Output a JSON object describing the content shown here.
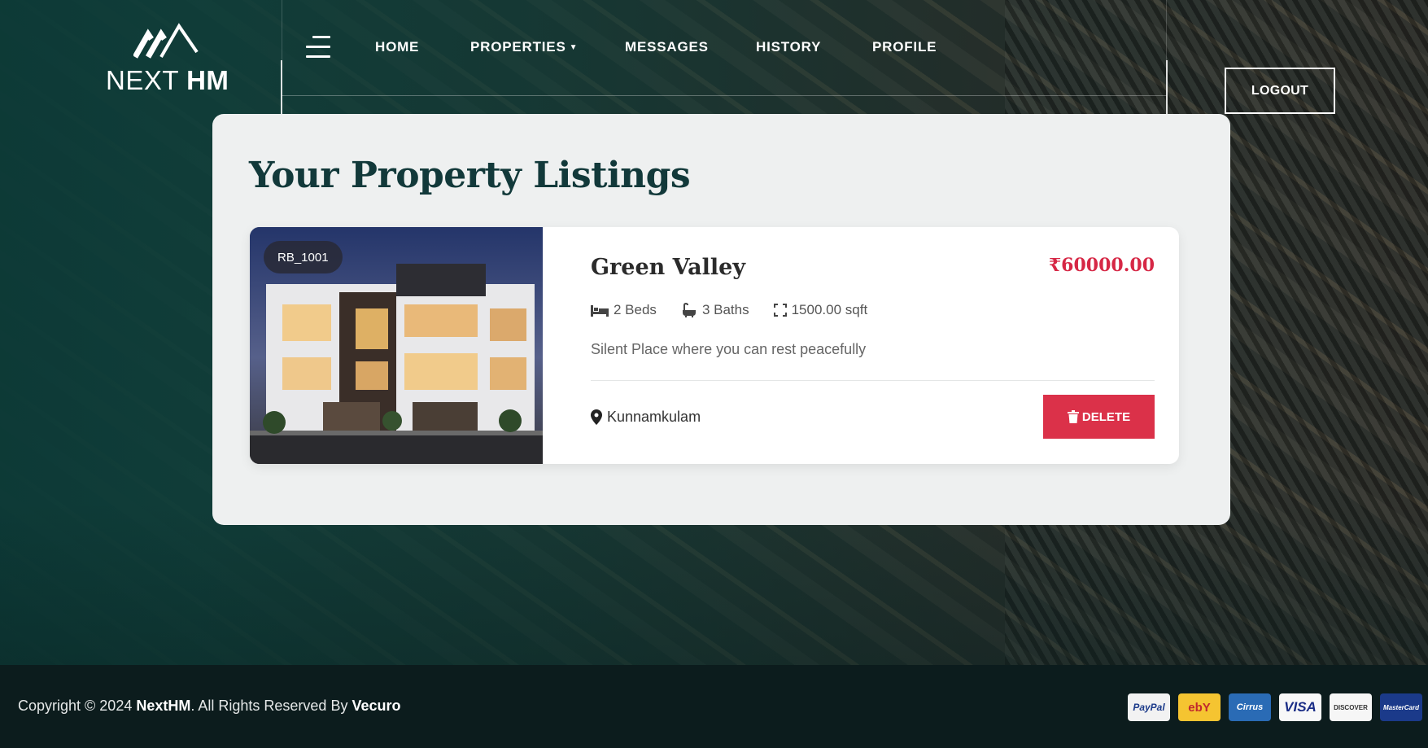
{
  "brand": {
    "logo_text_light": "NEXT ",
    "logo_text_bold": "HM"
  },
  "nav": {
    "items": [
      {
        "label": "HOME"
      },
      {
        "label": "PROPERTIES",
        "has_caret": true
      },
      {
        "label": "MESSAGES"
      },
      {
        "label": "HISTORY"
      },
      {
        "label": "PROFILE"
      }
    ],
    "logout_label": "LOGOUT"
  },
  "main": {
    "title": "Your Property Listings",
    "listings": [
      {
        "id": "RB_1001",
        "name": "Green Valley",
        "price": "₹60000.00",
        "beds": "2 Beds",
        "baths": "3 Baths",
        "area": "1500.00 sqft",
        "description": "Silent Place where you can rest peacefully",
        "location": "Kunnamkulam",
        "delete_label": "DELETE"
      }
    ]
  },
  "footer": {
    "copyright_prefix": "Copyright © 2024 ",
    "company": "NextHM",
    "rights": ". All Rights Reserved By ",
    "author": "Vecuro",
    "payment_methods": [
      "PayPal",
      "ebY",
      "Cirrus",
      "VISA",
      "DISCOVER",
      "MasterCard"
    ]
  },
  "colors": {
    "accent": "#db3149",
    "title": "#12393a",
    "footer_bg": "#0c1c1d"
  }
}
